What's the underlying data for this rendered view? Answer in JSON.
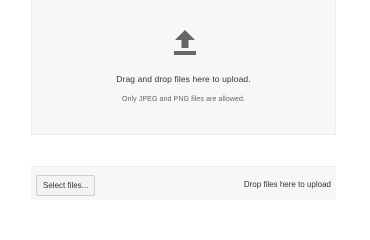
{
  "dropzone": {
    "icon": "upload-icon",
    "title": "Drag and drop files here to upload.",
    "hint": "Only JPEG and PNG files are allowed."
  },
  "footer": {
    "select_label": "Select files...",
    "drop_label": "Drop files here to upload"
  },
  "colors": {
    "panel_bg": "#f7f7f7",
    "icon": "#666666",
    "text": "#333333"
  }
}
